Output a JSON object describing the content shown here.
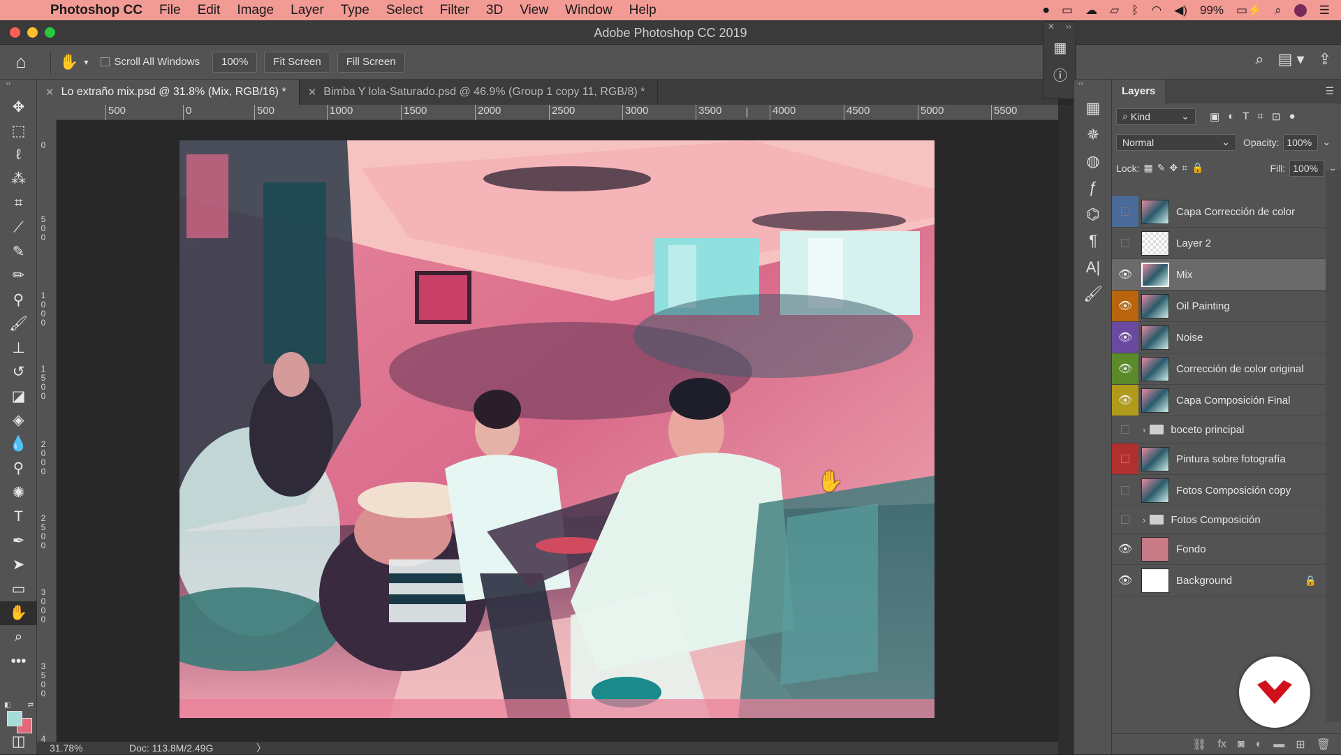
{
  "menubar": {
    "app_name": "Photoshop CC",
    "items": [
      "File",
      "Edit",
      "Image",
      "Layer",
      "Type",
      "Select",
      "Filter",
      "3D",
      "View",
      "Window",
      "Help"
    ],
    "battery": "99%"
  },
  "window": {
    "title": "Adobe Photoshop CC 2019"
  },
  "options": {
    "scroll_all_windows": "Scroll All Windows",
    "zoom_value": "100%",
    "fit_screen": "Fit Screen",
    "fill_screen": "Fill Screen"
  },
  "tabs": [
    {
      "label": "Lo extraño mix.psd @ 31.8% (Mix, RGB/16) *",
      "active": true
    },
    {
      "label": "Bimba Y lola-Saturado.psd @ 46.9% (Group 1 copy 11, RGB/8) *",
      "active": false
    }
  ],
  "ruler": {
    "top": [
      "500",
      "0",
      "500",
      "1000",
      "1500",
      "2000",
      "2500",
      "3000",
      "3500",
      "4000",
      "4500",
      "5000",
      "5500"
    ],
    "left": [
      "0",
      "5\n0\n0",
      "1\n0\n0\n0",
      "1\n5\n0\n0",
      "2\n0\n0\n0",
      "2\n5\n0\n0",
      "3\n0\n0\n0",
      "3\n5\n0\n0",
      "4"
    ]
  },
  "status": {
    "zoom": "31.78%",
    "doc": "Doc: 113.8M/2.49G",
    "arrow": "〉"
  },
  "layers_panel": {
    "tab": "Layers",
    "filter_kind": "Kind",
    "blend_mode": "Normal",
    "opacity_label": "Opacity:",
    "opacity_value": "100%",
    "lock_label": "Lock:",
    "fill_label": "Fill:",
    "fill_value": "100%",
    "layers": [
      {
        "name": "Capa Corrección de color",
        "color": "#4a6a9a",
        "visible": false,
        "type": "layer"
      },
      {
        "name": "Layer 2",
        "color": "",
        "visible": false,
        "type": "transparent"
      },
      {
        "name": "Mix",
        "color": "",
        "visible": true,
        "type": "layer",
        "selected": true
      },
      {
        "name": "Oil Painting",
        "color": "#b8650e",
        "visible": true,
        "type": "layer"
      },
      {
        "name": "Noise",
        "color": "#6a4aa0",
        "visible": true,
        "type": "layer"
      },
      {
        "name": "Corrección de color original",
        "color": "#5a8a2a",
        "visible": true,
        "type": "layer"
      },
      {
        "name": "Capa Composición Final",
        "color": "#b09a1a",
        "visible": true,
        "type": "layer"
      },
      {
        "name": "boceto principal",
        "color": "",
        "visible": false,
        "type": "group"
      },
      {
        "name": "Pintura sobre fotografía",
        "color": "#b03030",
        "visible": false,
        "type": "layer"
      },
      {
        "name": "Fotos Composición copy",
        "color": "",
        "visible": false,
        "type": "layer"
      },
      {
        "name": "Fotos Composición",
        "color": "",
        "visible": false,
        "type": "group"
      },
      {
        "name": "Fondo",
        "color": "",
        "visible": true,
        "type": "pink"
      },
      {
        "name": "Background",
        "color": "",
        "visible": true,
        "type": "white",
        "locked": true
      }
    ]
  },
  "colors": {
    "menubar": "#f29a94",
    "foreground_swatch": "#a8dcd8",
    "background_swatch": "#e06a78",
    "logo_red": "#d0101a"
  }
}
